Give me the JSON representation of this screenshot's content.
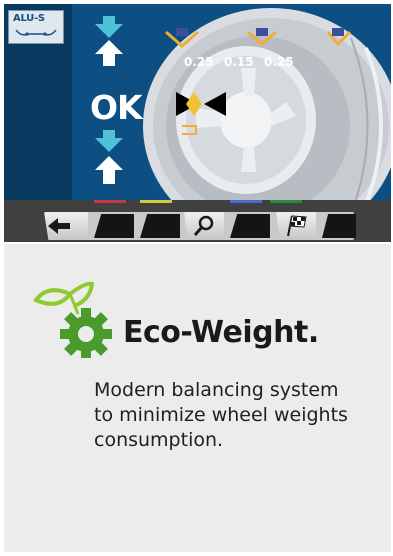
{
  "screen": {
    "badge_label": "ALU-S",
    "status": "OK",
    "weights": {
      "left": "0.25",
      "center": "0.15",
      "right": "0.25"
    },
    "toolbar": {
      "buttons": [
        "back",
        "blank",
        "blank",
        "zoom",
        "blank",
        "blank",
        "flag"
      ],
      "tab_colors": [
        "#c23b3b",
        "#d8c640",
        "#2a8a3c",
        "#4a6ad8"
      ]
    }
  },
  "info": {
    "title": "Eco-Weight.",
    "description": "Modern balancing system to minimize wheel weights consumption.",
    "accent_color": "#4a9a2c",
    "leaf_color": "#8fca2e"
  }
}
